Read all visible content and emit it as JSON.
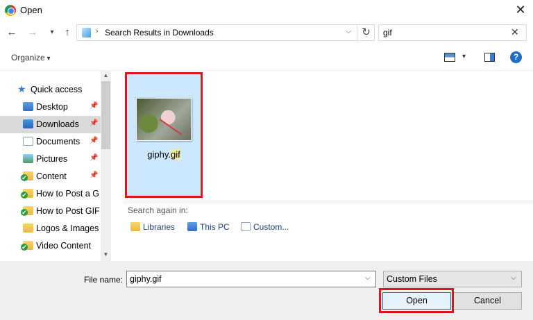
{
  "window": {
    "title": "Open",
    "close_glyph": "✕"
  },
  "nav": {
    "back_glyph": "←",
    "forward_glyph": "→",
    "recent_glyph": "▾",
    "up_glyph": "↑",
    "address_sep": "›",
    "address_text": "Search Results in Downloads",
    "address_dropdown_glyph": "⌵",
    "refresh_glyph": "↻",
    "search_value": "gif",
    "search_clear_glyph": "✕"
  },
  "toolbar": {
    "organize_label": "Organize",
    "help_glyph": "?"
  },
  "sidebar": {
    "pin_glyph": "📌",
    "items": [
      {
        "label": "Quick access",
        "icon": "star-icon",
        "glyph": "★"
      },
      {
        "label": "Desktop",
        "icon": "desktop-folder-icon",
        "pinned": true
      },
      {
        "label": "Downloads",
        "icon": "downloads-folder-icon",
        "pinned": true,
        "selected": true
      },
      {
        "label": "Documents",
        "icon": "documents-folder-icon",
        "pinned": true
      },
      {
        "label": "Pictures",
        "icon": "pictures-folder-icon",
        "pinned": true
      },
      {
        "label": "Content",
        "icon": "synced-folder-icon",
        "pinned": true
      },
      {
        "label": "How to Post a GIF",
        "icon": "synced-folder-icon"
      },
      {
        "label": "How to Post GIFs",
        "icon": "synced-folder-icon"
      },
      {
        "label": "Logos & Images",
        "icon": "folder-icon"
      },
      {
        "label": "Video Content",
        "icon": "synced-folder-icon"
      }
    ],
    "scroll_up_glyph": "▲",
    "scroll_down_glyph": "▼"
  },
  "content": {
    "file": {
      "name_base": "giphy.",
      "name_match": "gif"
    },
    "search_again_label": "Search again in:",
    "search_again_links": [
      "Libraries",
      "This PC",
      "Custom..."
    ]
  },
  "bottom": {
    "filename_label": "File name:",
    "filename_value": "giphy.gif",
    "dropdown_glyph": "⌵",
    "filter_value": "Custom Files",
    "open_label": "Open",
    "cancel_label": "Cancel"
  },
  "colors": {
    "highlight_box": "#e0141a",
    "selection": "#cce8ff",
    "accent": "#0078d7"
  }
}
